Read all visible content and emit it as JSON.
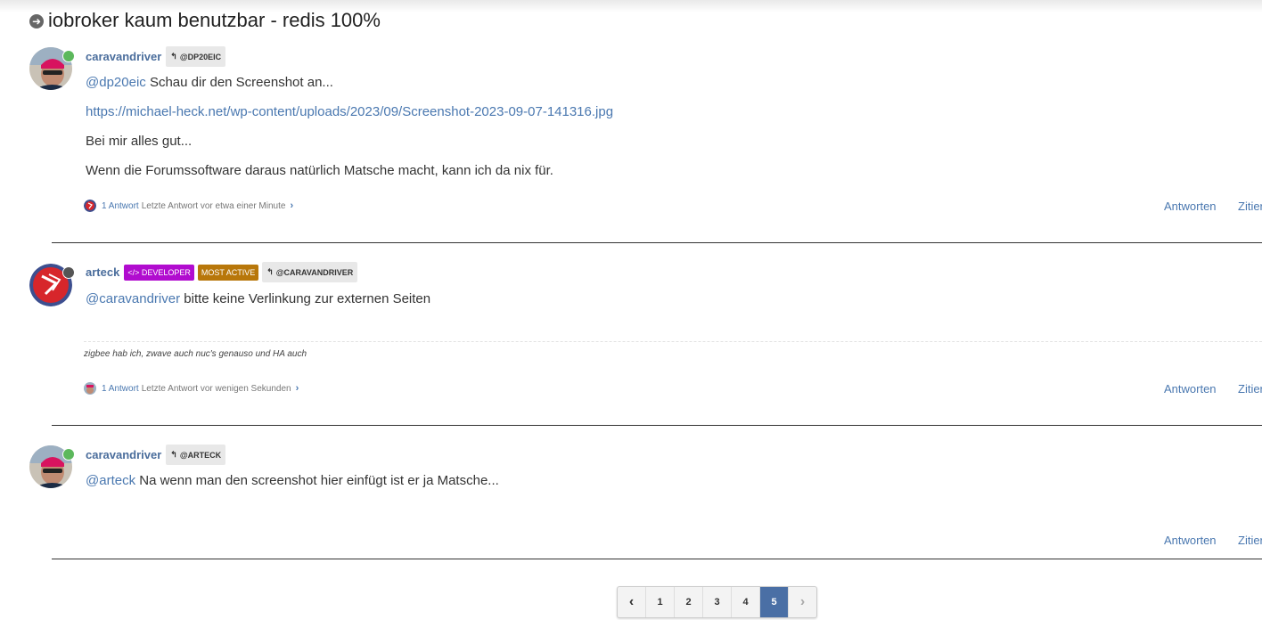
{
  "topic": {
    "title": "iobroker kaum benutzbar - redis 100%"
  },
  "posts": [
    {
      "author": "caravandriver",
      "reply_to": "@DP20EIC",
      "lines": {
        "mention": "@dp20eic",
        "text1": " Schau dir den Screenshot an...",
        "link": "https://michael-heck.net/wp-content/uploads/2023/09/Screenshot-2023-09-07-141316.jpg",
        "text2": "Bei mir alles gut...",
        "text3": "Wenn die Forumssoftware daraus natürlich Matsche macht, kann ich da nix für."
      },
      "replies_count": "1 Antwort",
      "replies_time": "Letzte Antwort vor etwa einer Minute",
      "reply_label": "Antworten",
      "quote_label": "Zitieren"
    },
    {
      "author": "arteck",
      "badges": {
        "developer": "DEVELOPER",
        "most_active": "MOST ACTIVE"
      },
      "reply_to": "@CARAVANDRIVER",
      "lines": {
        "mention": "@caravandriver",
        "text1": " bitte keine Verlinkung zur externen Seiten"
      },
      "signature": "zigbee hab ich, zwave auch nuc's genauso und HA auch",
      "replies_count": "1 Antwort",
      "replies_time": "Letzte Antwort vor wenigen Sekunden",
      "reply_label": "Antworten",
      "quote_label": "Zitieren"
    },
    {
      "author": "caravandriver",
      "reply_to": "@ARTECK",
      "lines": {
        "mention": "@arteck",
        "text1": " Na wenn man den screenshot hier einfügt ist er ja Matsche..."
      },
      "reply_label": "Antworten",
      "quote_label": "Zitieren"
    }
  ],
  "pagination": {
    "pages": [
      "1",
      "2",
      "3",
      "4",
      "5"
    ],
    "current": "5"
  },
  "colors": {
    "link": "#4a78b0",
    "online": "#5cb85c",
    "developer_badge": "#b10ccf",
    "most_active_badge": "#b8770a",
    "current_page": "#4a6fa5"
  }
}
